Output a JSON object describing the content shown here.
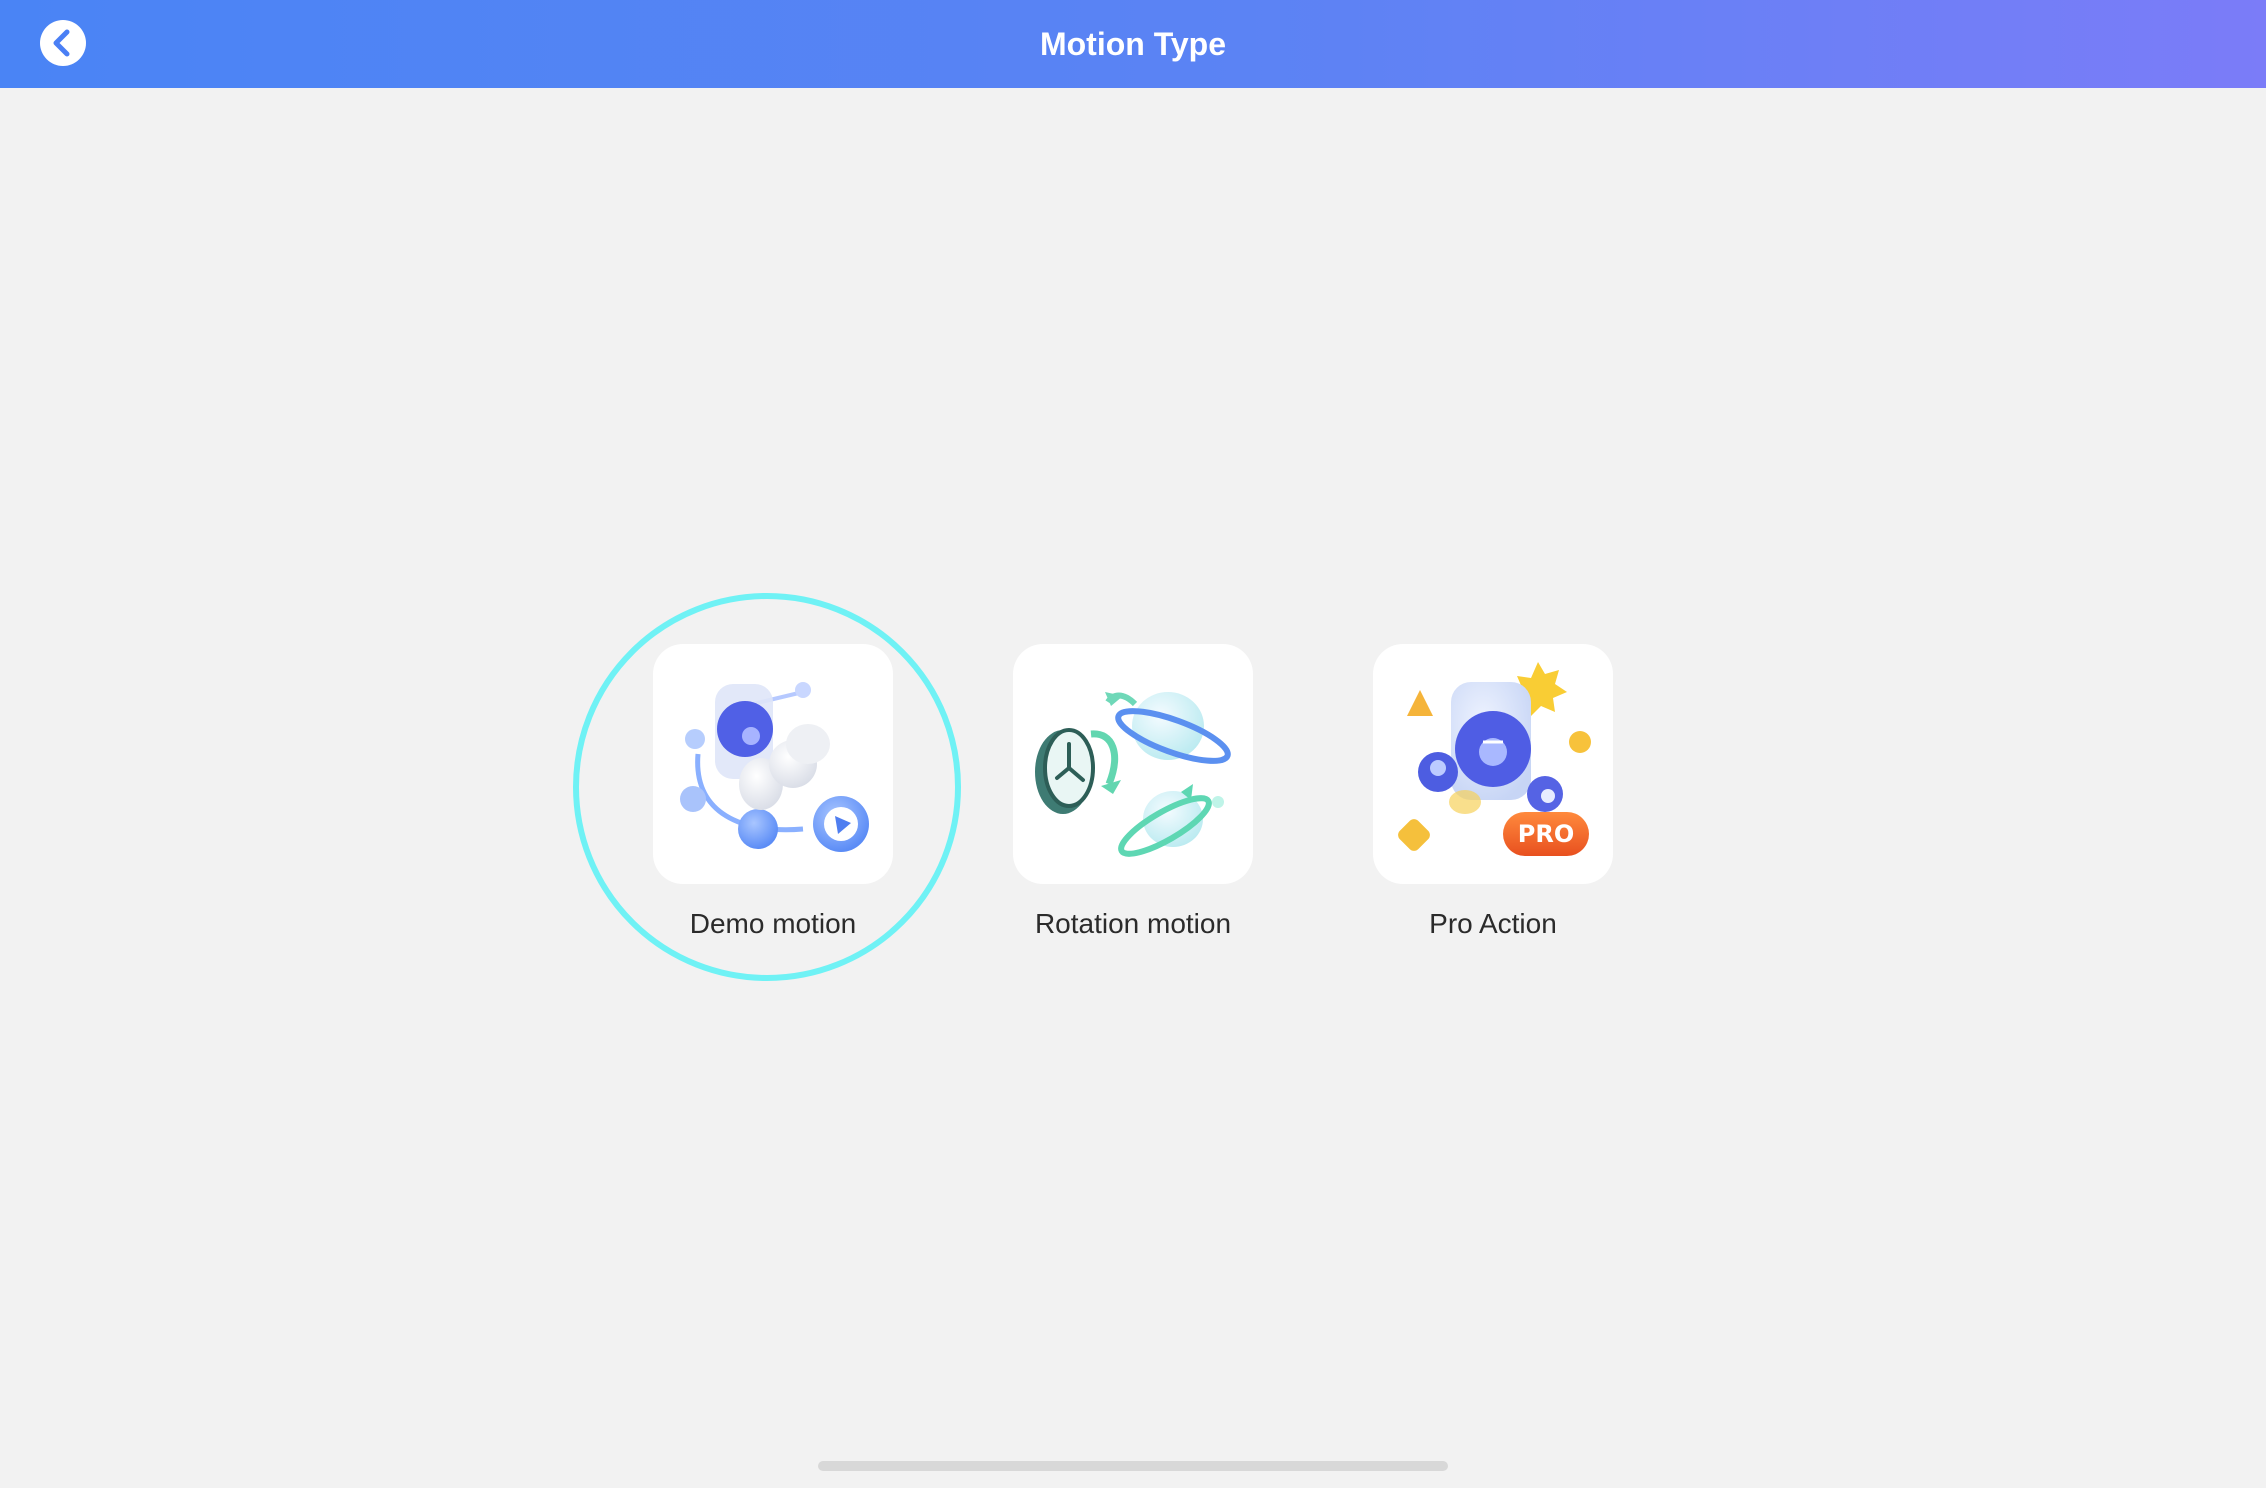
{
  "header": {
    "title": "Motion Type",
    "back_icon": "chevron-left-icon",
    "gradient_start": "#4a84f5",
    "gradient_end": "#7b7cf8"
  },
  "cards": [
    {
      "label": "Demo motion",
      "icon": "demo-motion-icon",
      "selected": true
    },
    {
      "label": "Rotation motion",
      "icon": "rotation-motion-icon",
      "selected": false
    },
    {
      "label": "Pro Action",
      "icon": "pro-action-icon",
      "badge": "PRO",
      "selected": false
    }
  ],
  "colors": {
    "background": "#f2f2f2",
    "selection_ring": "#6ff2f5",
    "pro_badge": "#f36b2c"
  }
}
